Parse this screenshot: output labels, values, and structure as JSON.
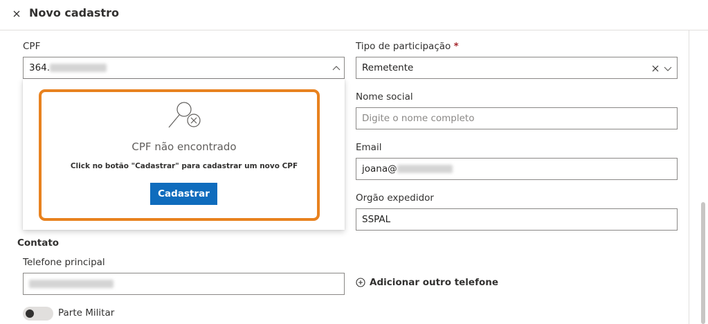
{
  "header": {
    "title": "Novo cadastro",
    "close_icon": "close-icon"
  },
  "cpf": {
    "label": "CPF",
    "value": "364.",
    "value_masked": true,
    "chevron_icon": "chevron-up-icon"
  },
  "not_found": {
    "icon": "search-not-found-icon",
    "title": "CPF não encontrado",
    "description": "Click no botão \"Cadastrar\" para cadastrar um novo CPF",
    "button_label": "Cadastrar",
    "highlight_color": "#e8821f"
  },
  "tipo": {
    "label": "Tipo de participação",
    "required_mark": "*",
    "value": "Remetente",
    "clear_icon": "clear-icon",
    "chevron_icon": "chevron-down-icon"
  },
  "nome_social": {
    "label": "Nome social",
    "placeholder": "Digite o nome completo"
  },
  "email": {
    "label": "Email",
    "value": "joana@",
    "value_masked": true
  },
  "orgao": {
    "label": "Orgão expedidor",
    "value": "SSPAL"
  },
  "contato": {
    "section_label": "Contato",
    "phone_label": "Telefone principal",
    "phone_masked": true,
    "add_phone_label": "Adicionar outro telefone",
    "add_icon": "add-circle-icon"
  },
  "militar": {
    "label": "Parte Militar",
    "enabled": false
  },
  "colors": {
    "primary": "#0f6cbd",
    "border": "#8a8886",
    "required": "#a4262c"
  }
}
